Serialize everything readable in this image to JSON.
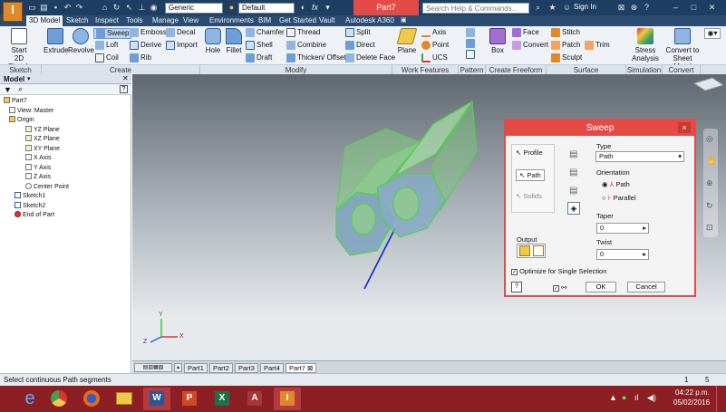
{
  "app": {
    "logo_letter": "I",
    "doc_title": "Part7",
    "search_placeholder": "Search Help & Commands...",
    "sign_in": "Sign In",
    "material_combo": "Generic",
    "appearance_combo": "Default",
    "qat_fx": "fx"
  },
  "tabs": [
    "3D Model",
    "Sketch",
    "Inspect",
    "Tools",
    "Manage",
    "View",
    "Environments",
    "BIM",
    "Get Started",
    "Vault",
    "Autodesk A360"
  ],
  "ribbon": {
    "sketch": {
      "start_label": "Start",
      "start_label2": "2D Sketch",
      "group": "Sketch"
    },
    "create": {
      "extrude": "Extrude",
      "revolve": "Revolve",
      "sweep": "Sweep",
      "loft": "Loft",
      "coil": "Coil",
      "emboss": "Emboss",
      "derive": "Derive",
      "rib": "Rib",
      "decal": "Decal",
      "import": "Import",
      "group": "Create"
    },
    "modify": {
      "hole": "Hole",
      "fillet": "Fillet",
      "chamfer": "Chamfer",
      "shell": "Shell",
      "draft": "Draft",
      "thread": "Thread",
      "combine": "Combine",
      "thicken": "Thicken/ Offset",
      "split": "Split",
      "direct": "Direct",
      "delete_face": "Delete Face",
      "group": "Modify"
    },
    "work": {
      "plane": "Plane",
      "axis": "Axis",
      "point": "Point",
      "ucs": "UCS",
      "group": "Work Features"
    },
    "pattern": {
      "group": "Pattern"
    },
    "freeform": {
      "box": "Box",
      "face": "Face",
      "convert": "Convert",
      "group": "Create Freeform"
    },
    "surface": {
      "stitch": "Stitch",
      "patch": "Patch",
      "sculpt": "Sculpt",
      "trim": "Trim",
      "group": "Surface"
    },
    "simulation": {
      "stress": "Stress",
      "analysis": "Analysis",
      "group": "Simulation"
    },
    "convert_grp": {
      "sheet1": "Convert to",
      "sheet2": "Sheet Metal",
      "group": "Convert"
    }
  },
  "browser": {
    "title": "Model",
    "help": "?",
    "items": [
      {
        "label": "Part7",
        "indent": 0
      },
      {
        "label": "View: Master",
        "indent": 1
      },
      {
        "label": "Origin",
        "indent": 1
      },
      {
        "label": "YZ Plane",
        "indent": 2
      },
      {
        "label": "XZ Plane",
        "indent": 2
      },
      {
        "label": "XY Plane",
        "indent": 2
      },
      {
        "label": "X Axis",
        "indent": 2
      },
      {
        "label": "Y Axis",
        "indent": 2
      },
      {
        "label": "Z Axis",
        "indent": 2
      },
      {
        "label": "Center Point",
        "indent": 2
      },
      {
        "label": "Sketch1",
        "indent": 1
      },
      {
        "label": "Sketch2",
        "indent": 1
      },
      {
        "label": "End of Part",
        "indent": 1
      }
    ]
  },
  "sweep_dialog": {
    "title": "Sweep",
    "close": "×",
    "profile": "Profile",
    "path": "Path",
    "solids": "Solids",
    "output": "Output",
    "type_label": "Type",
    "type_value": "Path",
    "orientation_label": "Orientation",
    "orient_path": "Path",
    "orient_parallel": "Parallel",
    "taper_label": "Taper",
    "taper_value": "0",
    "twist_label": "Twist",
    "twist_value": "0",
    "optimize": "Optimize for Single Selection",
    "ok": "OK",
    "cancel": "Cancel",
    "help": "?"
  },
  "doc_tabs": [
    "Part1",
    "Part2",
    "Part3",
    "Part4",
    "Part7"
  ],
  "status": {
    "message": "Select continuous Path segments",
    "n1": "1",
    "n2": "5"
  },
  "taskbar": {
    "time": "04:22 p.m.",
    "date": "05/02/2016"
  },
  "colors": {
    "titlebar": "#1e3f63",
    "accent_red": "#e24b46",
    "taskbar": "#8c1f23",
    "model_green": "#4fd24a"
  },
  "axes": {
    "x": "X",
    "y": "Y",
    "z": "Z"
  }
}
